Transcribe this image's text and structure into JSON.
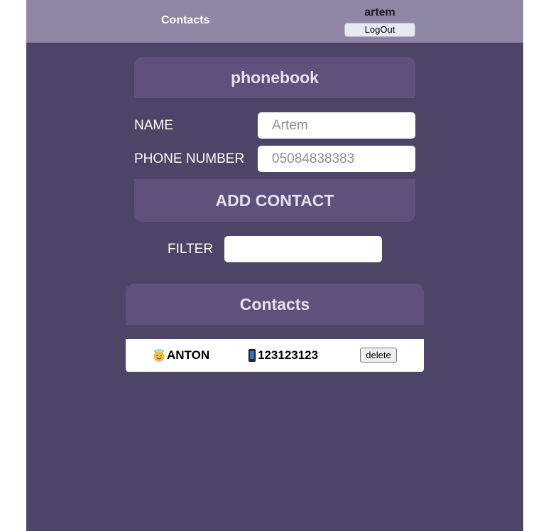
{
  "header": {
    "nav_link": "Contacts",
    "user_name": "artem",
    "logout_label": "LogOut"
  },
  "form": {
    "title": "phonebook",
    "name_label": "NAME",
    "name_placeholder": "Artem",
    "phone_label": "PHONE NUMBER",
    "phone_placeholder": "05084838383",
    "submit_label": "ADD CONTACT"
  },
  "filter": {
    "label": "FILTER",
    "value": ""
  },
  "contacts": {
    "title": "Contacts",
    "items": [
      {
        "name": "ANTON",
        "name_icon": "smiling-face-with-halo-icon",
        "phone": "123123123",
        "phone_icon": "mobile-phone-icon",
        "delete_label": "delete"
      }
    ]
  },
  "colors": {
    "background": "#4c4567",
    "header": "#8f86a6",
    "panel": "#5e527d",
    "panel_text": "#e4e0ee"
  }
}
